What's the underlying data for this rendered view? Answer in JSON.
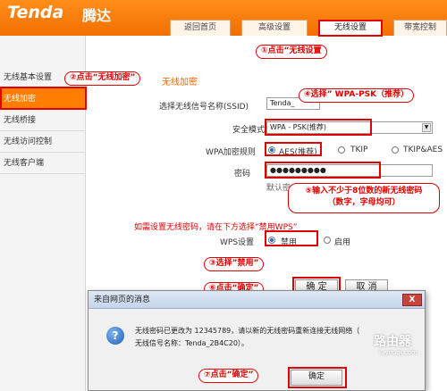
{
  "header": {
    "logo": "Tenda",
    "logo_cn": "腾达",
    "tabs": [
      "返回首页",
      "高级设置",
      "无线设置",
      "带宽控制"
    ]
  },
  "sidebar": {
    "items": [
      "无线基本设置",
      "无线加密",
      "无线桥接",
      "无线访问控制",
      "无线客户端"
    ]
  },
  "main": {
    "section_title": "无线加密",
    "ssid_label": "选择无线信号名称(SSID)",
    "ssid_value": "Tenda_",
    "security_label": "安全模式",
    "security_value": "WPA - PSK(推荐)",
    "wpa_rule_label": "WPA加密规则",
    "wpa_rules": [
      "AES(推荐)",
      "TKIP",
      "TKIP&AES"
    ],
    "password_label": "密码",
    "password_value": "●●●●●●●●●",
    "password_hint": "默认密",
    "wps_note": "如需设置无线密码，请在下方选择“禁用WPS”",
    "wps_label": "WPS设置",
    "wps_options": [
      "禁用",
      "启用"
    ],
    "ok_label": "确 定",
    "cancel_label": "取 消"
  },
  "annotations": {
    "step1": "①点击“无线设置",
    "step2": "②点击“无线加密”",
    "step4": "④选择” WPA-PSK（推荐）",
    "step5_line1": "⑤输入不少于8位数的新无线密码",
    "step5_line2": "（数字，字母均可）",
    "step3": "③选择”禁用”",
    "step6": "⑥点击“确定”",
    "step7": "⑦点击“确定”"
  },
  "dialog": {
    "title": "来自网页的消息",
    "close": "X",
    "line1": "无线密码已更改为 12345789，请以新的无线密码重新连接无线网络（",
    "line2": "无线信号名称：Tenda_2B4C20）。",
    "ok_label": "确定"
  },
  "watermark": {
    "title": "路由器",
    "site": "luyouqi.com"
  },
  "colors": {
    "header_orange": "#f57a0a",
    "annotation_red": "#e00000",
    "active_sidebar": "#ff7d00"
  }
}
